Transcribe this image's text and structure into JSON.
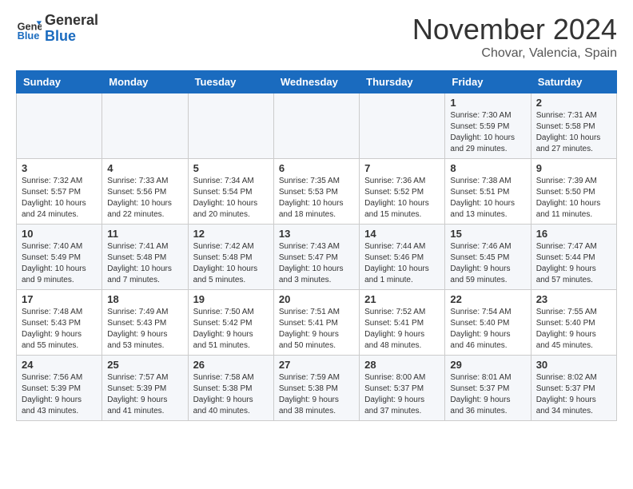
{
  "header": {
    "logo_line1": "General",
    "logo_line2": "Blue",
    "month": "November 2024",
    "location": "Chovar, Valencia, Spain"
  },
  "weekdays": [
    "Sunday",
    "Monday",
    "Tuesday",
    "Wednesday",
    "Thursday",
    "Friday",
    "Saturday"
  ],
  "weeks": [
    [
      {
        "day": "",
        "info": ""
      },
      {
        "day": "",
        "info": ""
      },
      {
        "day": "",
        "info": ""
      },
      {
        "day": "",
        "info": ""
      },
      {
        "day": "",
        "info": ""
      },
      {
        "day": "1",
        "info": "Sunrise: 7:30 AM\nSunset: 5:59 PM\nDaylight: 10 hours\nand 29 minutes."
      },
      {
        "day": "2",
        "info": "Sunrise: 7:31 AM\nSunset: 5:58 PM\nDaylight: 10 hours\nand 27 minutes."
      }
    ],
    [
      {
        "day": "3",
        "info": "Sunrise: 7:32 AM\nSunset: 5:57 PM\nDaylight: 10 hours\nand 24 minutes."
      },
      {
        "day": "4",
        "info": "Sunrise: 7:33 AM\nSunset: 5:56 PM\nDaylight: 10 hours\nand 22 minutes."
      },
      {
        "day": "5",
        "info": "Sunrise: 7:34 AM\nSunset: 5:54 PM\nDaylight: 10 hours\nand 20 minutes."
      },
      {
        "day": "6",
        "info": "Sunrise: 7:35 AM\nSunset: 5:53 PM\nDaylight: 10 hours\nand 18 minutes."
      },
      {
        "day": "7",
        "info": "Sunrise: 7:36 AM\nSunset: 5:52 PM\nDaylight: 10 hours\nand 15 minutes."
      },
      {
        "day": "8",
        "info": "Sunrise: 7:38 AM\nSunset: 5:51 PM\nDaylight: 10 hours\nand 13 minutes."
      },
      {
        "day": "9",
        "info": "Sunrise: 7:39 AM\nSunset: 5:50 PM\nDaylight: 10 hours\nand 11 minutes."
      }
    ],
    [
      {
        "day": "10",
        "info": "Sunrise: 7:40 AM\nSunset: 5:49 PM\nDaylight: 10 hours\nand 9 minutes."
      },
      {
        "day": "11",
        "info": "Sunrise: 7:41 AM\nSunset: 5:48 PM\nDaylight: 10 hours\nand 7 minutes."
      },
      {
        "day": "12",
        "info": "Sunrise: 7:42 AM\nSunset: 5:48 PM\nDaylight: 10 hours\nand 5 minutes."
      },
      {
        "day": "13",
        "info": "Sunrise: 7:43 AM\nSunset: 5:47 PM\nDaylight: 10 hours\nand 3 minutes."
      },
      {
        "day": "14",
        "info": "Sunrise: 7:44 AM\nSunset: 5:46 PM\nDaylight: 10 hours\nand 1 minute."
      },
      {
        "day": "15",
        "info": "Sunrise: 7:46 AM\nSunset: 5:45 PM\nDaylight: 9 hours\nand 59 minutes."
      },
      {
        "day": "16",
        "info": "Sunrise: 7:47 AM\nSunset: 5:44 PM\nDaylight: 9 hours\nand 57 minutes."
      }
    ],
    [
      {
        "day": "17",
        "info": "Sunrise: 7:48 AM\nSunset: 5:43 PM\nDaylight: 9 hours\nand 55 minutes."
      },
      {
        "day": "18",
        "info": "Sunrise: 7:49 AM\nSunset: 5:43 PM\nDaylight: 9 hours\nand 53 minutes."
      },
      {
        "day": "19",
        "info": "Sunrise: 7:50 AM\nSunset: 5:42 PM\nDaylight: 9 hours\nand 51 minutes."
      },
      {
        "day": "20",
        "info": "Sunrise: 7:51 AM\nSunset: 5:41 PM\nDaylight: 9 hours\nand 50 minutes."
      },
      {
        "day": "21",
        "info": "Sunrise: 7:52 AM\nSunset: 5:41 PM\nDaylight: 9 hours\nand 48 minutes."
      },
      {
        "day": "22",
        "info": "Sunrise: 7:54 AM\nSunset: 5:40 PM\nDaylight: 9 hours\nand 46 minutes."
      },
      {
        "day": "23",
        "info": "Sunrise: 7:55 AM\nSunset: 5:40 PM\nDaylight: 9 hours\nand 45 minutes."
      }
    ],
    [
      {
        "day": "24",
        "info": "Sunrise: 7:56 AM\nSunset: 5:39 PM\nDaylight: 9 hours\nand 43 minutes."
      },
      {
        "day": "25",
        "info": "Sunrise: 7:57 AM\nSunset: 5:39 PM\nDaylight: 9 hours\nand 41 minutes."
      },
      {
        "day": "26",
        "info": "Sunrise: 7:58 AM\nSunset: 5:38 PM\nDaylight: 9 hours\nand 40 minutes."
      },
      {
        "day": "27",
        "info": "Sunrise: 7:59 AM\nSunset: 5:38 PM\nDaylight: 9 hours\nand 38 minutes."
      },
      {
        "day": "28",
        "info": "Sunrise: 8:00 AM\nSunset: 5:37 PM\nDaylight: 9 hours\nand 37 minutes."
      },
      {
        "day": "29",
        "info": "Sunrise: 8:01 AM\nSunset: 5:37 PM\nDaylight: 9 hours\nand 36 minutes."
      },
      {
        "day": "30",
        "info": "Sunrise: 8:02 AM\nSunset: 5:37 PM\nDaylight: 9 hours\nand 34 minutes."
      }
    ]
  ]
}
